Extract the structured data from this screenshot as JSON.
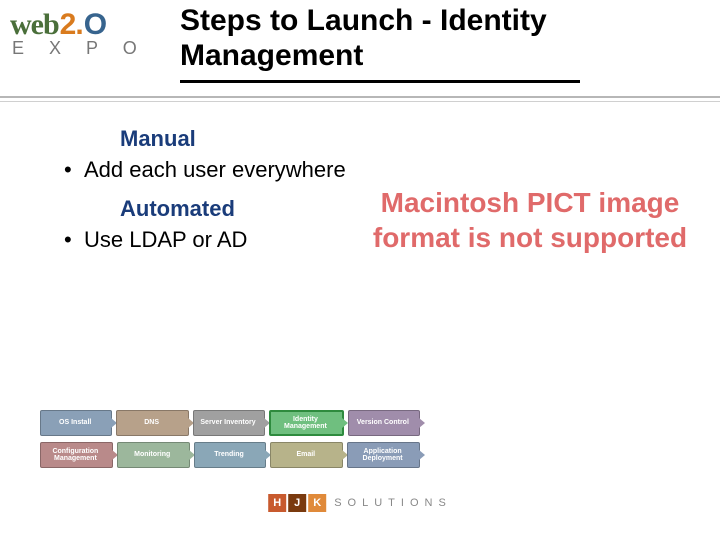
{
  "header": {
    "logo": {
      "word1": "web",
      "word2a": "2.",
      "word2b": "O",
      "expo": "E X P O"
    },
    "title": "Steps to Launch - Identity Management"
  },
  "content": {
    "subhead1": "Manual",
    "bullets1": [
      "Add each user everywhere"
    ],
    "subhead2": "Automated",
    "bullets2": [
      "Use LDAP or AD"
    ]
  },
  "pict_error": "Macintosh PICT image format is not supported",
  "steps": {
    "row1": [
      "OS Install",
      "DNS",
      "Server Inventory",
      "Identity Management",
      "Version Control"
    ],
    "row2": [
      "Configuration Management",
      "Monitoring",
      "Trending",
      "Email",
      "Application Deployment"
    ]
  },
  "footer": {
    "h": "H",
    "j": "J",
    "k": "K",
    "solutions": "SOLUTIONS"
  }
}
